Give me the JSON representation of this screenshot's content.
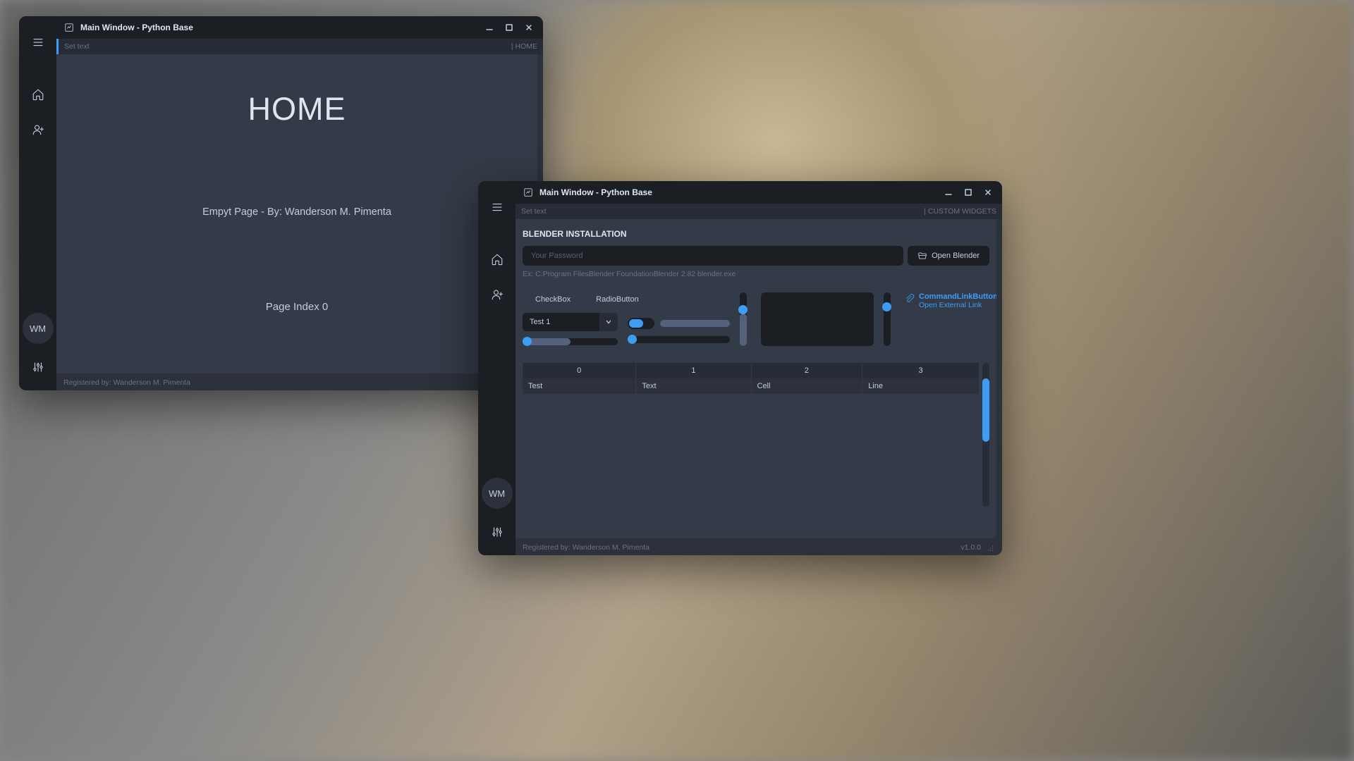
{
  "win1": {
    "title": "Main Window - Python Base",
    "subbar_left": "Set text",
    "subbar_right": "| HOME",
    "home_title": "HOME",
    "home_subtitle": "Empyt Page - By: Wanderson M. Pimenta",
    "home_index": "Page Index 0",
    "avatar": "WM",
    "status_left": "Registered by: Wanderson M. Pimenta"
  },
  "win2": {
    "title": "Main Window - Python Base",
    "subbar_left": "Set text",
    "subbar_right": "| CUSTOM WIDGETS",
    "section": "BLENDER INSTALLATION",
    "password_placeholder": "Your Password",
    "open_btn": "Open Blender",
    "hint": "Ex: C:Program FilesBlender FoundationBlender 2.82 blender.exe",
    "checkbox_label": "CheckBox",
    "radio_label": "RadioButton",
    "dropdown_value": "Test 1",
    "clink_title": "CommandLinkButton",
    "clink_sub": "Open External Link",
    "table_headers": [
      "0",
      "1",
      "2",
      "3"
    ],
    "table_row": [
      "Test",
      "Text",
      "Cell",
      "Line"
    ],
    "avatar": "WM",
    "status_left": "Registered by: Wanderson M. Pimenta",
    "version": "v1.0.0"
  }
}
